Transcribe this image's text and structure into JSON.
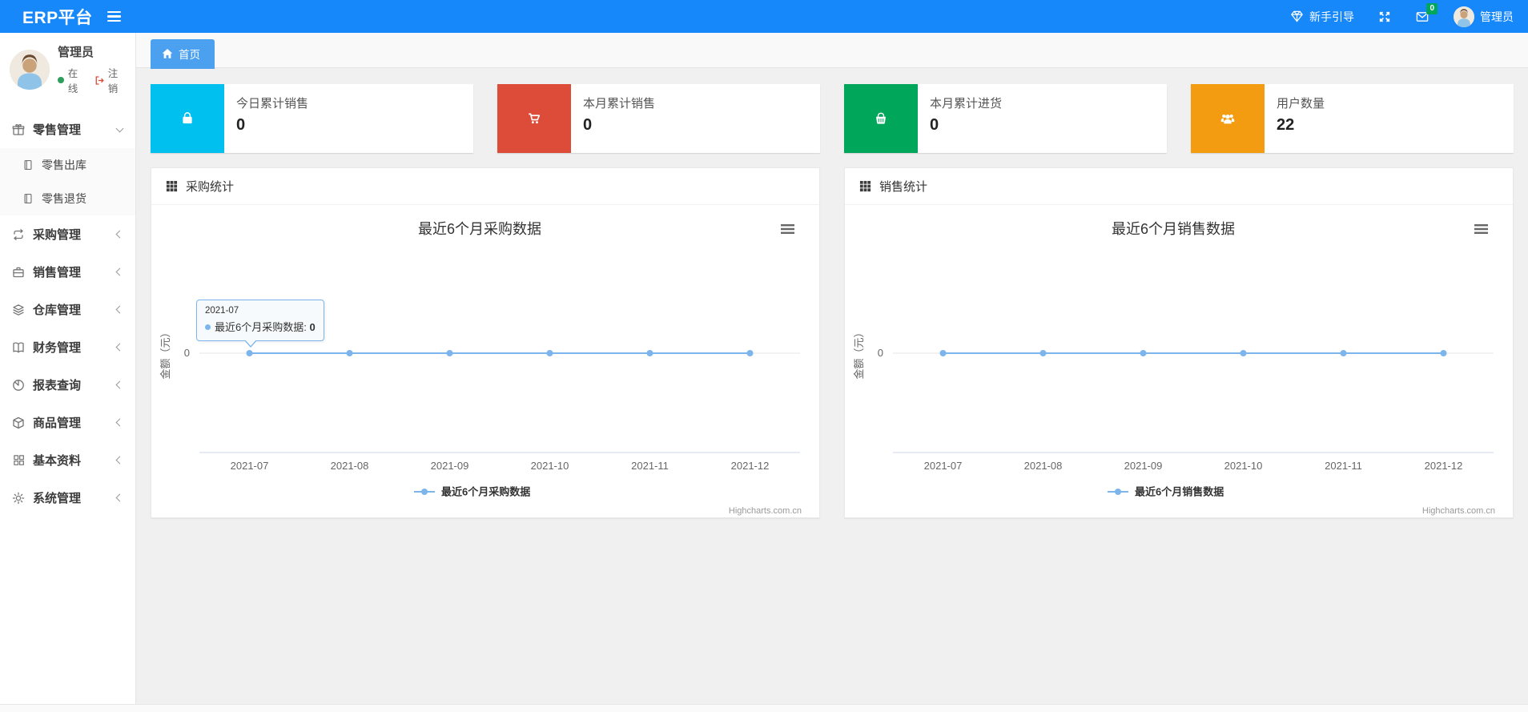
{
  "navbar": {
    "brand": "ERP平台",
    "guide_label": "新手引导",
    "mail_badge": "0",
    "user_name": "管理员"
  },
  "sidebar": {
    "user": {
      "name": "管理员",
      "status_label": "在线",
      "logout_label": "注销"
    },
    "items": [
      {
        "label": "零售管理",
        "icon": "gift-icon",
        "state": "expanded",
        "children": [
          {
            "label": "零售出库",
            "icon": "file-icon"
          },
          {
            "label": "零售退货",
            "icon": "file-icon"
          }
        ]
      },
      {
        "label": "采购管理",
        "icon": "loop-icon",
        "state": "collapsed"
      },
      {
        "label": "销售管理",
        "icon": "briefcase-icon",
        "state": "collapsed"
      },
      {
        "label": "仓库管理",
        "icon": "layers-icon",
        "state": "collapsed"
      },
      {
        "label": "财务管理",
        "icon": "book-icon",
        "state": "collapsed"
      },
      {
        "label": "报表查询",
        "icon": "pie-chart-icon",
        "state": "collapsed"
      },
      {
        "label": "商品管理",
        "icon": "box-icon",
        "state": "collapsed"
      },
      {
        "label": "基本资料",
        "icon": "grid-icon",
        "state": "collapsed"
      },
      {
        "label": "系统管理",
        "icon": "gear-icon",
        "state": "collapsed"
      }
    ]
  },
  "tabs": {
    "home_label": "首页"
  },
  "stat_cards": [
    {
      "label": "今日累计销售",
      "value": "0",
      "icon": "shopping-bag-icon",
      "color": "#00c0ef"
    },
    {
      "label": "本月累计销售",
      "value": "0",
      "icon": "cart-icon",
      "color": "#dd4b39"
    },
    {
      "label": "本月累计进货",
      "value": "0",
      "icon": "basket-icon",
      "color": "#00a65a"
    },
    {
      "label": "用户数量",
      "value": "22",
      "icon": "users-icon",
      "color": "#f39c12"
    }
  ],
  "panels": [
    {
      "title": "采购统计"
    },
    {
      "title": "销售统计"
    }
  ],
  "chart_data": [
    {
      "type": "line",
      "title": "最近6个月采购数据",
      "categories": [
        "2021-07",
        "2021-08",
        "2021-09",
        "2021-10",
        "2021-11",
        "2021-12"
      ],
      "series": [
        {
          "name": "最近6个月采购数据",
          "values": [
            0,
            0,
            0,
            0,
            0,
            0
          ],
          "color": "#7cb5ec"
        }
      ],
      "xlabel": "",
      "ylabel": "金额（元）",
      "ytick_labels": [
        "0"
      ],
      "grid": true,
      "legend_position": "bottom",
      "watermark": "Highcharts.com.cn",
      "tooltip": {
        "visible": true,
        "point_index": 0,
        "header": "2021-07",
        "label": "最近6个月采购数据",
        "value": "0"
      }
    },
    {
      "type": "line",
      "title": "最近6个月销售数据",
      "categories": [
        "2021-07",
        "2021-08",
        "2021-09",
        "2021-10",
        "2021-11",
        "2021-12"
      ],
      "series": [
        {
          "name": "最近6个月销售数据",
          "values": [
            0,
            0,
            0,
            0,
            0,
            0
          ],
          "color": "#7cb5ec"
        }
      ],
      "xlabel": "",
      "ylabel": "金额（元）",
      "ytick_labels": [
        "0"
      ],
      "grid": true,
      "legend_position": "bottom",
      "watermark": "Highcharts.com.cn",
      "tooltip": {
        "visible": false
      }
    }
  ]
}
